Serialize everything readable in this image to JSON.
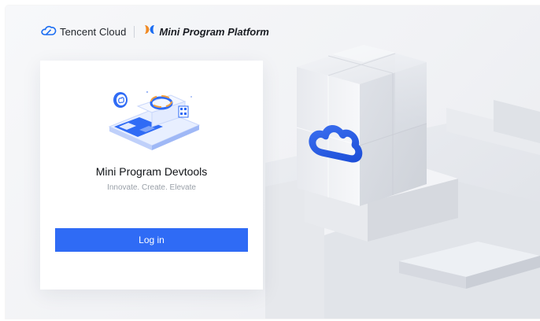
{
  "header": {
    "tencent_cloud_label": "Tencent Cloud",
    "platform_label": "Mini Program Platform"
  },
  "login_card": {
    "title": "Mini Program Devtools",
    "subtitle": "Innovate. Create. Elevate",
    "login_button_label": "Log in"
  },
  "colors": {
    "accent": "#2f6bf5",
    "tencent_blue": "#1a6cf2",
    "mp_orange": "#f08a24"
  },
  "icons": {
    "tencent_cloud": "tencent-cloud-icon",
    "mini_program": "mini-program-butterfly-icon",
    "hero_cube_logo": "cloud-logo-icon"
  }
}
